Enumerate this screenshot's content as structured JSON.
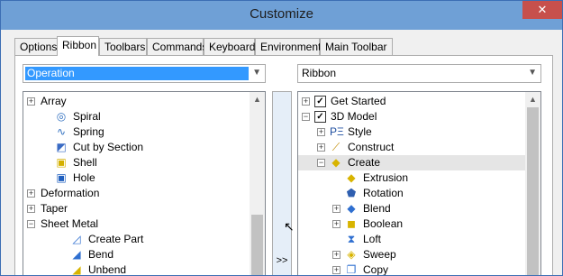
{
  "window": {
    "title": "Customize",
    "close": "✕"
  },
  "tabs": [
    "Options",
    "Ribbon",
    "Toolbars",
    "Commands",
    "Keyboard",
    "Environment",
    "Main Toolbar"
  ],
  "left_combo": {
    "value": "Operation"
  },
  "right_combo": {
    "value": "Ribbon"
  },
  "left_tree": [
    {
      "label": "Array",
      "level": 0,
      "expander": "+"
    },
    {
      "label": "Spiral",
      "level": 1,
      "icon": "spiral-icon",
      "glyph": "◎",
      "color": "#3070c0"
    },
    {
      "label": "Spring",
      "level": 1,
      "icon": "spring-icon",
      "glyph": "∿",
      "color": "#3070c0"
    },
    {
      "label": "Cut by Section",
      "level": 1,
      "icon": "cut-section-icon",
      "glyph": "◩",
      "color": "#3a6bc4"
    },
    {
      "label": "Shell",
      "level": 1,
      "icon": "shell-icon",
      "glyph": "▣",
      "color": "#d4b000"
    },
    {
      "label": "Hole",
      "level": 1,
      "icon": "hole-icon",
      "glyph": "▣",
      "color": "#1f5fbf"
    },
    {
      "label": "Deformation",
      "level": 0,
      "expander": "+"
    },
    {
      "label": "Taper",
      "level": 0,
      "expander": "+"
    },
    {
      "label": "Sheet Metal",
      "level": 0,
      "expander": "−"
    },
    {
      "label": "Create Part",
      "level": 2,
      "icon": "create-part-icon",
      "glyph": "◿",
      "color": "#2f6fd0"
    },
    {
      "label": "Bend",
      "level": 2,
      "icon": "bend-icon",
      "glyph": "◢",
      "color": "#2f6fd0"
    },
    {
      "label": "Unbend",
      "level": 2,
      "icon": "unbend-icon",
      "glyph": "◢",
      "color": "#d8b400"
    }
  ],
  "right_tree": [
    {
      "label": "Get Started",
      "level": 0,
      "expander": "+",
      "checked": true
    },
    {
      "label": "3D Model",
      "level": 0,
      "expander": "−",
      "checked": true
    },
    {
      "label": "Style",
      "level": 1,
      "expander": "+",
      "icon": "style-icon",
      "glyph": "PΞ",
      "color": "#1f4fa0"
    },
    {
      "label": "Construct",
      "level": 1,
      "expander": "+",
      "icon": "construct-icon",
      "glyph": "⟋",
      "color": "#c08a00"
    },
    {
      "label": "Create",
      "level": 1,
      "expander": "−",
      "icon": "create-icon",
      "glyph": "◆",
      "color": "#d8b400",
      "highlight": true
    },
    {
      "label": "Extrusion",
      "level": 2,
      "icon": "extrusion-icon",
      "glyph": "◆",
      "color": "#d8b400"
    },
    {
      "label": "Rotation",
      "level": 2,
      "icon": "rotation-icon",
      "glyph": "⬟",
      "color": "#2f5fb0"
    },
    {
      "label": "Blend",
      "level": 2,
      "expander": "+",
      "icon": "blend-icon",
      "glyph": "◆",
      "color": "#2f6fd0"
    },
    {
      "label": "Boolean",
      "level": 2,
      "expander": "+",
      "icon": "boolean-icon",
      "glyph": "◼",
      "color": "#d8b400"
    },
    {
      "label": "Loft",
      "level": 2,
      "icon": "loft-icon",
      "glyph": "⧗",
      "color": "#2f6fd0"
    },
    {
      "label": "Sweep",
      "level": 2,
      "expander": "+",
      "icon": "sweep-icon",
      "glyph": "◈",
      "color": "#d8b400"
    },
    {
      "label": "Copy",
      "level": 2,
      "expander": "+",
      "icon": "copy-icon",
      "glyph": "❐",
      "color": "#2f6fd0"
    }
  ],
  "mover": {
    "label": ">>"
  }
}
